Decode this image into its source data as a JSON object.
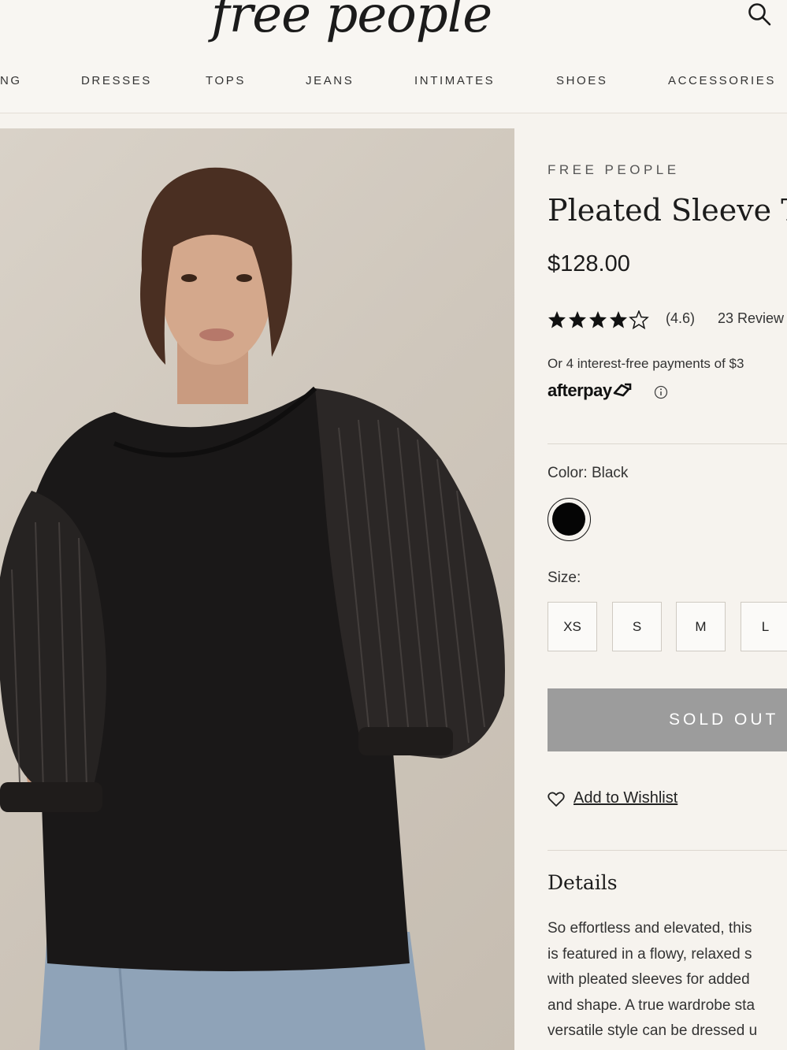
{
  "header": {
    "logo_text": "free people",
    "nav": [
      "NG",
      "DRESSES",
      "TOPS",
      "JEANS",
      "INTIMATES",
      "SHOES",
      "ACCESSORIES"
    ]
  },
  "product": {
    "brand": "FREE PEOPLE",
    "title": "Pleated Sleeve To",
    "price": "$128.00",
    "rating": 4.6,
    "rating_text": "(4.6)",
    "reviews": "23 Review",
    "payments_text": "Or 4 interest-free payments of $3",
    "afterpay_text": "afterpay",
    "color_label": "Color: Black",
    "swatch_color": "#050505",
    "size_label": "Size:",
    "sizes": [
      "XS",
      "S",
      "M",
      "L"
    ],
    "sold_out_label": "SOLD OUT",
    "wishlist_label": "Add to Wishlist",
    "details_heading": "Details",
    "description_lines": [
      "So effortless and elevated, this",
      "is featured in a flowy, relaxed s",
      "with pleated sleeves for added",
      "and shape. A true wardrobe sta",
      "versatile style can be dressed u"
    ]
  },
  "colors": {
    "background": "#f6f3ee",
    "sold_out_bg": "#9c9c9c",
    "text": "#222222"
  },
  "icons": [
    "search-icon",
    "star-icon",
    "info-icon",
    "heart-icon",
    "afterpay-arrow-icon"
  ]
}
